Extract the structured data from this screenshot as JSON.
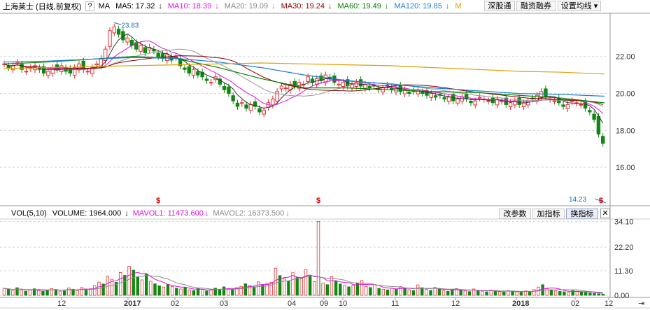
{
  "main_header": {
    "stock": "上海莱士 (日线,前复权)",
    "question": "?",
    "ma_label": "MA",
    "items": [
      {
        "text": "MA5: 17.32",
        "arrow": "↓",
        "color": "#000000",
        "arrow_color": "#000000"
      },
      {
        "text": "MA10: 18.39",
        "arrow": "↓",
        "color": "#e010e0",
        "arrow_color": "#e010e0"
      },
      {
        "text": "MA20: 19.09",
        "arrow": "↓",
        "color": "#888888",
        "arrow_color": "#888888"
      },
      {
        "text": "MA30: 19.24",
        "arrow": "↓",
        "color": "#8b0000",
        "arrow_color": "#8b0000"
      },
      {
        "text": "MA60: 19.49",
        "arrow": "↓",
        "color": "#008000",
        "arrow_color": "#008000"
      },
      {
        "text": "MA120: 19.85",
        "arrow": "↓",
        "color": "#1a7fd6",
        "arrow_color": "#1a7fd6"
      },
      {
        "text": "M",
        "arrow": "",
        "color": "#e0a000",
        "arrow_color": "#e0a000"
      }
    ],
    "buttons": [
      "深股通",
      "融资融券",
      "设置均线 ▾"
    ]
  },
  "vol_header": {
    "text": "VOL(5,10)",
    "volume": "VOLUME: 1964.000",
    "volume_arrow": "↓",
    "mavol1": "MAVOL1: 11473.600",
    "mavol1_arrow": "↓",
    "mavol2": "MAVOL2: 16373.500",
    "mavol2_arrow": "↓",
    "buttons": [
      "改参数",
      "加指标",
      "换指标"
    ],
    "close": "✕"
  },
  "colors": {
    "up": "#e23333",
    "down": "#118811",
    "ma5": "#333333",
    "ma10": "#e010e0",
    "ma20": "#999999",
    "ma30": "#8b0000",
    "ma60": "#008000",
    "ma120": "#1a7fd6",
    "ma250": "#e0a000",
    "grid": "#cfd8e6",
    "mark": "#d40000",
    "annot": "#1a6fb8"
  },
  "chart_data": [
    {
      "type": "candlestick",
      "title": "上海莱士 (日线,前复权)",
      "y_ticks": [
        "22.00",
        "20.00",
        "18.00",
        "16.00"
      ],
      "ylim": [
        14.0,
        24.3
      ],
      "x_labels": [
        "12",
        "2017",
        "02",
        "03",
        "04",
        "09",
        "10",
        "11",
        "12",
        "2018",
        "02",
        "12"
      ],
      "annotations": [
        {
          "label": "23.83",
          "value": 23.83,
          "type": "high"
        },
        {
          "label": "14.23",
          "value": 14.23,
          "type": "low"
        }
      ],
      "markers": [
        "$",
        "$",
        "$"
      ],
      "ohlc_sample_note": "",
      "series": [
        {
          "name": "MA5",
          "value": 17.32
        },
        {
          "name": "MA10",
          "value": 18.39
        },
        {
          "name": "MA20",
          "value": 19.09
        },
        {
          "name": "MA30",
          "value": 19.24
        },
        {
          "name": "MA60",
          "value": 19.49
        },
        {
          "name": "MA120",
          "value": 19.85
        }
      ],
      "close_path": [
        21.6,
        21.4,
        21.5,
        21.7,
        21.3,
        21.2,
        21.4,
        21.5,
        21.3,
        21.1,
        21.2,
        21.4,
        21.3,
        21.5,
        21.2,
        21.1,
        21.4,
        21.6,
        21.3,
        21.2,
        21.4,
        21.6,
        21.9,
        22.4,
        23.4,
        23.6,
        23.2,
        22.9,
        23.0,
        22.6,
        22.4,
        22.6,
        22.2,
        22.5,
        22.3,
        22.0,
        21.9,
        22.1,
        21.8,
        22.0,
        21.5,
        21.3,
        21.1,
        21.3,
        21.0,
        20.9,
        20.7,
        20.6,
        20.9,
        20.5,
        20.2,
        20.0,
        19.6,
        19.3,
        19.5,
        19.2,
        19.4,
        19.3,
        19.0,
        19.1,
        19.5,
        19.7,
        20.1,
        20.4,
        20.3,
        20.5,
        20.4,
        20.6,
        20.5,
        20.9,
        20.6,
        20.8,
        20.7,
        21.0,
        20.8,
        20.6,
        20.5,
        20.6,
        20.4,
        20.5,
        20.6,
        20.4,
        20.5,
        20.3,
        20.4,
        20.2,
        20.3,
        20.4,
        20.2,
        20.3,
        20.1,
        20.2,
        20.0,
        20.1,
        20.2,
        20.0,
        19.9,
        20.0,
        19.8,
        19.9,
        19.7,
        19.8,
        19.6,
        19.7,
        19.8,
        19.7,
        19.5,
        19.6,
        19.8,
        19.7,
        19.6,
        19.5,
        19.7,
        19.6,
        19.4,
        19.5,
        19.6,
        19.4,
        19.5,
        19.6,
        19.7,
        19.9,
        20.1,
        19.8,
        19.7,
        19.6,
        19.5,
        19.3,
        19.4,
        19.6,
        19.5,
        19.4,
        19.2,
        19.0,
        18.6,
        17.8,
        17.3
      ],
      "ma250_path": [
        21.35,
        21.4,
        21.45,
        21.5,
        21.55,
        21.6,
        21.65,
        21.6,
        21.55,
        21.5,
        21.4,
        21.3,
        21.2,
        21.15,
        21.05
      ],
      "ma120_path": [
        21.7,
        21.75,
        21.85,
        21.95,
        21.9,
        21.7,
        21.4,
        21.0,
        20.7,
        20.5,
        20.3,
        20.15,
        20.0,
        19.95,
        19.85
      ],
      "ma60_path": [
        21.6,
        21.7,
        21.85,
        22.0,
        21.9,
        21.4,
        20.8,
        20.3,
        20.3,
        20.2,
        20.1,
        20.05,
        19.9,
        19.75,
        19.49
      ]
    },
    {
      "type": "bar",
      "title": "VOL(5,10)",
      "y_ticks": [
        "34.10",
        "22.20",
        "11.30",
        "0.00"
      ],
      "ylim": [
        0,
        35.5
      ],
      "series": [
        {
          "name": "MAVOL1",
          "value": 11473.6
        },
        {
          "name": "MAVOL2",
          "value": 16373.5
        }
      ],
      "values": [
        3.2,
        2.8,
        2.1,
        3.5,
        2.4,
        1.9,
        2.6,
        3.0,
        2.2,
        1.8,
        2.5,
        3.1,
        2.7,
        1.9,
        2.0,
        3.4,
        2.8,
        2.2,
        3.6,
        2.5,
        3.0,
        4.5,
        6.1,
        5.2,
        8.9,
        7.4,
        6.0,
        10.5,
        9.2,
        13.4,
        11.6,
        8.3,
        7.1,
        9.8,
        6.5,
        5.3,
        4.4,
        3.8,
        5.1,
        4.0,
        3.3,
        2.9,
        3.6,
        2.5,
        2.2,
        3.1,
        2.7,
        2.0,
        2.4,
        3.3,
        2.8,
        3.9,
        3.0,
        2.6,
        3.5,
        4.1,
        5.3,
        4.6,
        3.9,
        6.2,
        4.8,
        5.5,
        6.0,
        12.5,
        9.1,
        7.7,
        6.5,
        10.4,
        8.2,
        7.6,
        11.8,
        9.0,
        6.3,
        7.9,
        5.6,
        4.9,
        8.6,
        6.7,
        5.2,
        4.4,
        3.9,
        4.7,
        5.5,
        6.8,
        4.1,
        3.6,
        4.9,
        3.2,
        2.8,
        2.5,
        3.3,
        2.9,
        4.0,
        3.4,
        2.6,
        2.2,
        4.8,
        3.5,
        2.7,
        2.3,
        3.6,
        2.9,
        2.1,
        1.8,
        2.6,
        3.1,
        2.4,
        2.0,
        1.7,
        2.9,
        2.2,
        1.9,
        1.6,
        2.4,
        2.0,
        1.7,
        1.5,
        2.2,
        1.9,
        1.6,
        1.4,
        2.0,
        1.7,
        2.6,
        3.8,
        4.9,
        3.1,
        2.5,
        2.0,
        1.8,
        1.6,
        1.4,
        2.1,
        1.9,
        1.6,
        1.3,
        1.1,
        0.9,
        0.7,
        0.5
      ],
      "up_flags": [
        1,
        0,
        1,
        0,
        1,
        0,
        1,
        0,
        1,
        0,
        0,
        1,
        0,
        1,
        0,
        1,
        0,
        1,
        1,
        0,
        1,
        1,
        1,
        0,
        1,
        1,
        0,
        1,
        0,
        1,
        0,
        0,
        1,
        0,
        1,
        0,
        0,
        1,
        0,
        1,
        0,
        1,
        0,
        1,
        0,
        0,
        1,
        0,
        1,
        0,
        0,
        0,
        1,
        0,
        1,
        1,
        0,
        1,
        0,
        1,
        0,
        1,
        1,
        1,
        0,
        1,
        0,
        1,
        0,
        1,
        1,
        0,
        1,
        0,
        1,
        0,
        1,
        0,
        0,
        1,
        0,
        1,
        0,
        1,
        1,
        0,
        1,
        0,
        1,
        0,
        1,
        0,
        1,
        0,
        1,
        0,
        1,
        0,
        1,
        0,
        1,
        0,
        1,
        0,
        0,
        1,
        0,
        1,
        0,
        1,
        0,
        1,
        0,
        1,
        0,
        1,
        0,
        1,
        0,
        1,
        0,
        1,
        0,
        1,
        1,
        0,
        1,
        0,
        1,
        0,
        0,
        1,
        0,
        1,
        0,
        0,
        0,
        0,
        0,
        0
      ],
      "spike_label": "34.10"
    }
  ]
}
